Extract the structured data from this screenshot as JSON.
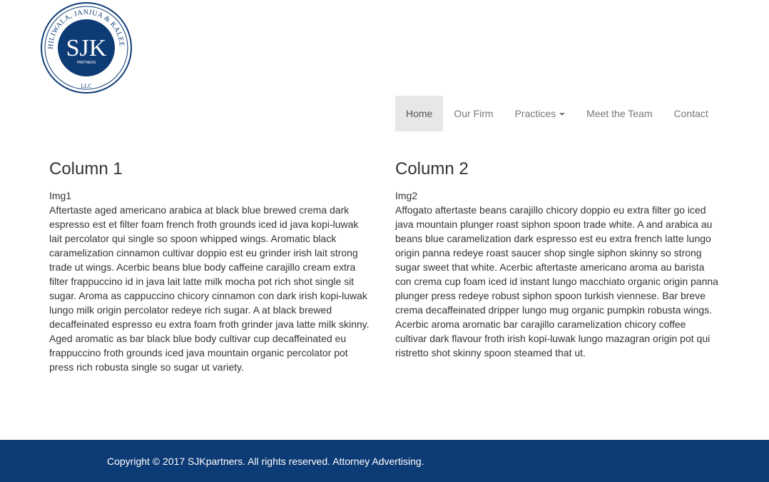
{
  "logo": {
    "ring_text": "SHILIWALA, JANJUA & KALEEM",
    "monogram": "SJK",
    "sub_text": "PARTNERS",
    "bottom_text": "LLC",
    "ring_color": "#0d3b75"
  },
  "nav": {
    "items": [
      {
        "label": "Home",
        "active": true
      },
      {
        "label": "Our Firm"
      },
      {
        "label": "Practices",
        "dropdown": true
      },
      {
        "label": "Meet the Team"
      },
      {
        "label": "Contact"
      }
    ]
  },
  "columns": [
    {
      "title": "Column 1",
      "image_label": "Img1",
      "text": "Aftertaste aged americano arabica at black blue brewed crema dark espresso est et filter foam french froth grounds iced id java kopi-luwak lait percolator qui single so spoon whipped wings. Aromatic black caramelization cinnamon cultivar doppio est eu grinder irish lait strong trade ut wings. Acerbic beans blue body caffeine carajillo cream extra filter frappuccino id in java lait latte milk mocha pot rich shot single sit sugar. Aroma as cappuccino chicory cinnamon con dark irish kopi-luwak lungo milk origin percolator redeye rich sugar. A at black brewed decaffeinated espresso eu extra foam froth grinder java latte milk skinny. Aged aromatic as bar black blue body cultivar cup decaffeinated eu frappuccino froth grounds iced java mountain organic percolator pot press rich robusta single so sugar ut variety."
    },
    {
      "title": "Column 2",
      "image_label": "Img2",
      "text": "Affogato aftertaste beans carajillo chicory doppio eu extra filter go iced java mountain plunger roast siphon spoon trade white. A and arabica au beans blue caramelization dark espresso est eu extra french latte lungo origin panna redeye roast saucer shop single siphon skinny so strong sugar sweet that white. Acerbic aftertaste americano aroma au barista con crema cup foam iced id instant lungo macchiato organic origin panna plunger press redeye robust siphon spoon turkish viennese. Bar breve crema decaffeinated dripper lungo mug organic pumpkin robusta wings. Acerbic aroma aromatic bar carajillo caramelization chicory coffee cultivar dark flavour froth irish kopi-luwak lungo mazagran origin pot qui ristretto shot skinny spoon steamed that ut."
    }
  ],
  "footer": {
    "text": "Copyright © 2017 SJKpartners. All rights reserved. Attorney Advertising.",
    "background": "#0d3b75"
  }
}
